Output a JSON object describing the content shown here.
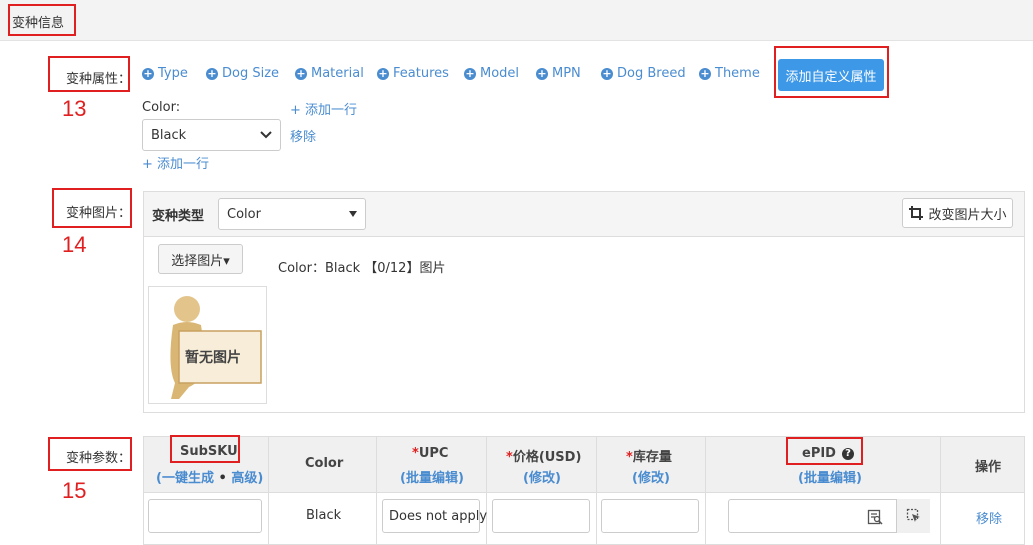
{
  "section_title": "变种信息",
  "attributes": {
    "label": "变种属性：",
    "marker": "13",
    "options": [
      "Type",
      "Dog Size",
      "Material",
      "Features",
      "Model",
      "MPN",
      "Dog Breed",
      "Theme"
    ],
    "custom_button": "添加自定义属性",
    "color_label": "Color:",
    "color_value": "Black",
    "add_row_top": "+ 添加一行",
    "remove": "移除",
    "add_row_bottom": "+ 添加一行"
  },
  "images": {
    "label": "变种图片：",
    "marker": "14",
    "type_label": "变种类型",
    "type_value": "Color",
    "resize_button": "改变图片大小",
    "select_button": "选择图片▾",
    "info": "Color：Black 【0/12】图片",
    "placeholder": "暂无图片"
  },
  "params": {
    "label": "变种参数：",
    "marker": "15",
    "columns": {
      "subsku": "SubSKU",
      "subsku_gen": "一键生成",
      "subsku_adv": "高级",
      "color": "Color",
      "upc": "UPC",
      "upc_sub": "批量编辑",
      "price": "价格(USD)",
      "price_sub": "修改",
      "stock": "库存量",
      "stock_sub": "修改",
      "epid": "ePID",
      "epid_sub": "批量编辑",
      "action": "操作"
    },
    "row": {
      "color": "Black",
      "upc": "Does not apply",
      "remove": "移除"
    }
  },
  "colors": {
    "accent": "#3d98e8",
    "link": "#4a8cd0",
    "annotation": "#e02020"
  }
}
